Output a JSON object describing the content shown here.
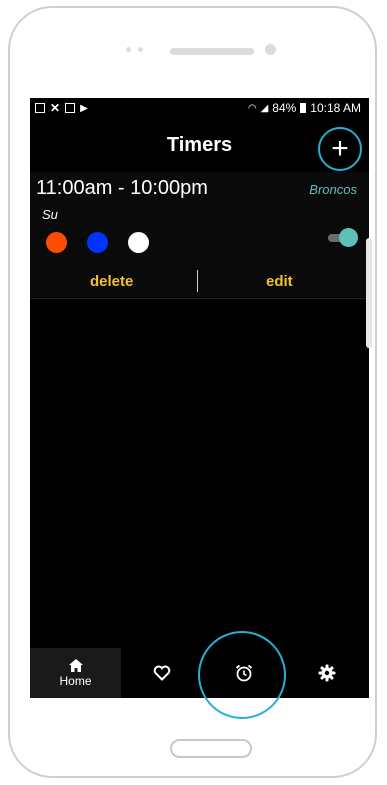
{
  "statusbar": {
    "left_icons": [
      "image-icon",
      "x-icon",
      "box-icon",
      "play-store-icon"
    ],
    "battery": "84%",
    "time": "10:18 AM"
  },
  "header": {
    "title": "Timers",
    "add_icon": "plus-icon"
  },
  "timer": {
    "time_range": "11:00am - 10:00pm",
    "team": "Broncos",
    "days": "Su",
    "colors": [
      "#fc4c02",
      "#0033ff",
      "#ffffff"
    ],
    "enabled": true,
    "delete_label": "delete",
    "edit_label": "edit"
  },
  "tabs": [
    {
      "icon": "home-icon",
      "label": "Home",
      "active": true
    },
    {
      "icon": "heart-icon",
      "label": ""
    },
    {
      "icon": "alarm-clock-icon",
      "label": ""
    },
    {
      "icon": "gear-icon",
      "label": ""
    }
  ],
  "colors": {
    "accent_ring": "#28b0d4",
    "action_text": "#f2c230",
    "team_text": "#5fc0b8"
  }
}
